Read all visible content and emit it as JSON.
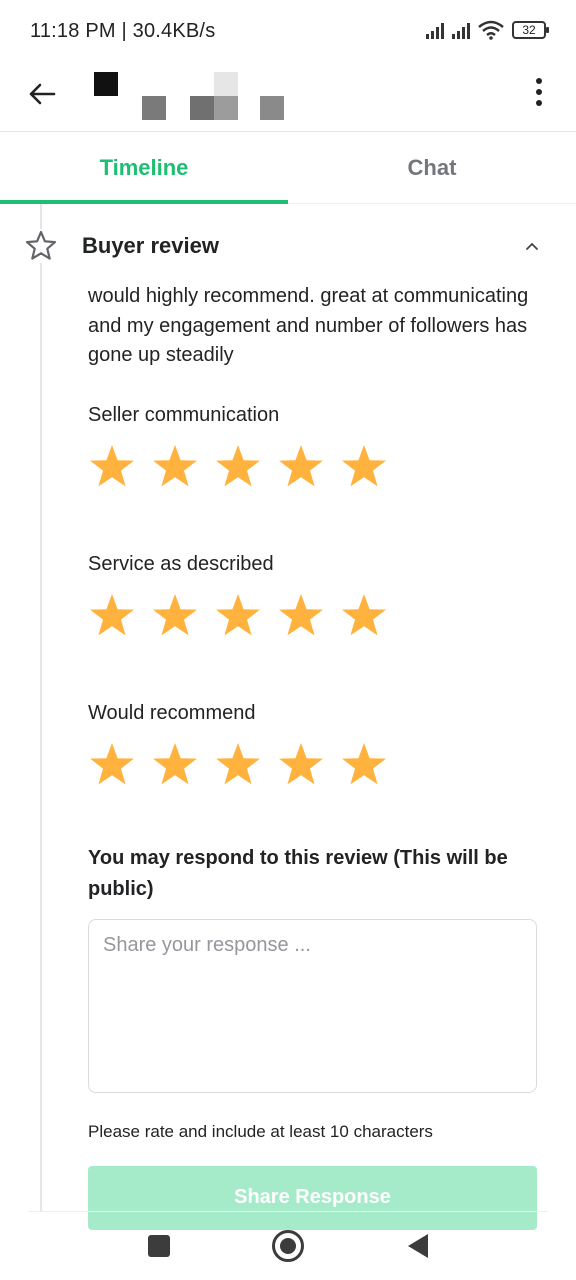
{
  "status_bar": {
    "time_and_speed": "11:18 PM | 30.4KB/s",
    "battery": "32"
  },
  "header": {
    "back_icon": "arrow-left-icon",
    "more_icon": "vertical-dots-icon"
  },
  "tabs": [
    {
      "label": "Timeline",
      "active": true
    },
    {
      "label": "Chat",
      "active": false
    }
  ],
  "review": {
    "title": "Buyer review",
    "text": "would highly recommend. great at communicating and my engagement and number of followers has gone up steadily",
    "ratings": [
      {
        "label": "Seller communication",
        "stars": 5,
        "max": 5
      },
      {
        "label": "Service as described",
        "stars": 5,
        "max": 5
      },
      {
        "label": "Would recommend",
        "stars": 5,
        "max": 5
      }
    ]
  },
  "response": {
    "title": "You may respond to this review (This will be public)",
    "value": "",
    "placeholder": "Share your response ...",
    "hint": "Please rate and include at least 10 characters",
    "button_label": "Share Response"
  },
  "colors": {
    "accent": "#1dbf73",
    "star": "#ffb33e",
    "button_disabled": "#a6ebc9"
  }
}
